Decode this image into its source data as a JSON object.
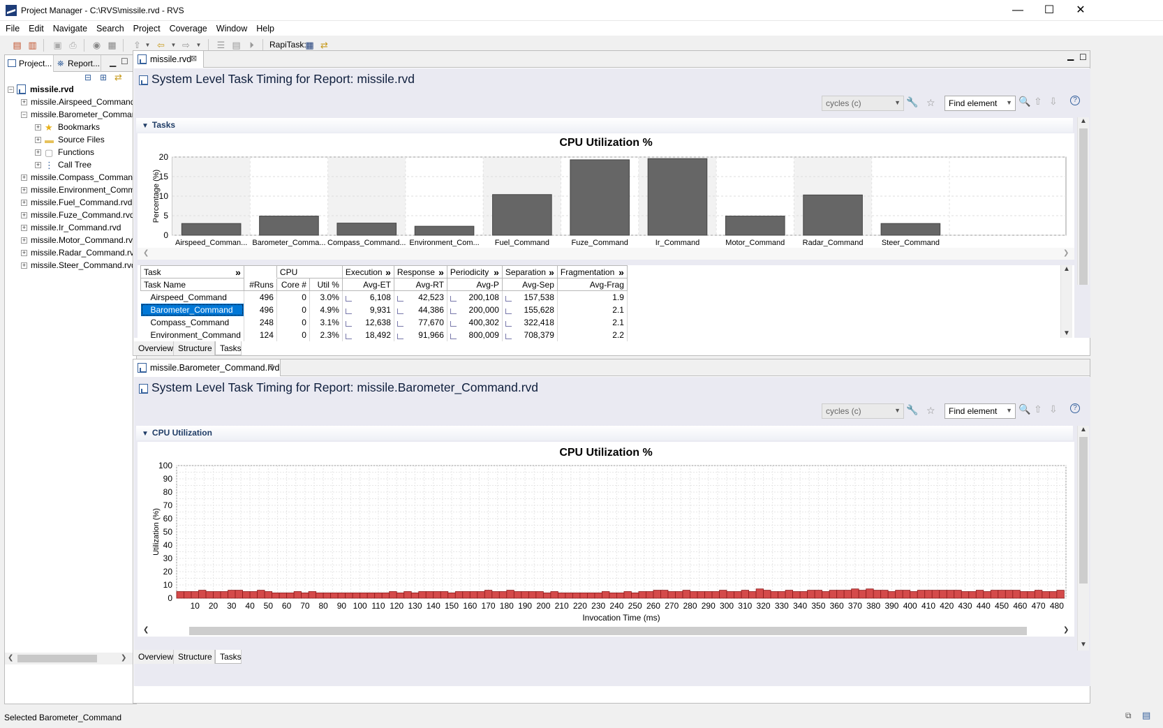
{
  "window": {
    "title": "Project Manager - C:\\RVS\\missile.rvd - RVS",
    "minimize": "—",
    "maximize": "☐",
    "close": "✕"
  },
  "menu": [
    "File",
    "Edit",
    "Navigate",
    "Search",
    "Project",
    "Coverage",
    "Window",
    "Help"
  ],
  "toolbar": {
    "rapitask_label": "RapiTask:"
  },
  "left_panel": {
    "tabs": [
      "Project...",
      "Report..."
    ],
    "tree": [
      {
        "label": "missile.rvd",
        "bold": true,
        "level": 0,
        "expander": "−"
      },
      {
        "label": "missile.Airspeed_Command.",
        "level": 1,
        "expander": "+"
      },
      {
        "label": "missile.Barometer_Comman",
        "level": 1,
        "expander": "−"
      },
      {
        "label": "Bookmarks",
        "level": 2,
        "expander": "+",
        "icon": "star-icon"
      },
      {
        "label": "Source Files",
        "level": 2,
        "expander": "+",
        "icon": "folder-icon"
      },
      {
        "label": "Functions",
        "level": 2,
        "expander": "+",
        "icon": "functions-icon"
      },
      {
        "label": "Call Tree",
        "level": 2,
        "expander": "+",
        "icon": "call-tree-icon"
      },
      {
        "label": "missile.Compass_Command",
        "level": 1,
        "expander": "+"
      },
      {
        "label": "missile.Environment_Comm",
        "level": 1,
        "expander": "+"
      },
      {
        "label": "missile.Fuel_Command.rvd",
        "level": 1,
        "expander": "+"
      },
      {
        "label": "missile.Fuze_Command.rvd",
        "level": 1,
        "expander": "+"
      },
      {
        "label": "missile.Ir_Command.rvd",
        "level": 1,
        "expander": "+"
      },
      {
        "label": "missile.Motor_Command.rv",
        "level": 1,
        "expander": "+"
      },
      {
        "label": "missile.Radar_Command.rvc",
        "level": 1,
        "expander": "+"
      },
      {
        "label": "missile.Steer_Command.rvd",
        "level": 1,
        "expander": "+"
      }
    ]
  },
  "top_editor": {
    "tab": "missile.rvd",
    "title": "System Level Task Timing for Report: missile.rvd",
    "units_combo": "cycles (c)",
    "find_combo": "Find element",
    "section": "Tasks",
    "bottom_tabs": [
      "Overview",
      "Structure",
      "Tasks"
    ],
    "table": {
      "group_headers": [
        "Task",
        "CPU",
        "Execution",
        "Response",
        "Periodicity",
        "Separation",
        "Fragmentation"
      ],
      "columns": [
        "Task Name",
        "#Runs",
        "Core #",
        "Util %",
        "Avg-ET",
        "Avg-RT",
        "Avg-P",
        "Avg-Sep",
        "Avg-Frag"
      ],
      "rows": [
        [
          "Airspeed_Command",
          "496",
          "0",
          "3.0%",
          "6,108",
          "42,523",
          "200,108",
          "157,538",
          "1.9"
        ],
        [
          "Barometer_Command",
          "496",
          "0",
          "4.9%",
          "9,931",
          "44,386",
          "200,000",
          "155,628",
          "2.1"
        ],
        [
          "Compass_Command",
          "248",
          "0",
          "3.1%",
          "12,638",
          "77,670",
          "400,302",
          "322,418",
          "2.1"
        ],
        [
          "Environment_Command",
          "124",
          "0",
          "2.3%",
          "18,492",
          "91,966",
          "800,009",
          "708,379",
          "2.2"
        ]
      ],
      "selected_row": 1
    }
  },
  "bottom_editor": {
    "tab": "missile.Barometer_Command.rvd",
    "title": "System Level Task Timing for Report: missile.Barometer_Command.rvd",
    "units_combo": "cycles (c)",
    "find_combo": "Find element",
    "section": "CPU Utilization",
    "bottom_tabs": [
      "Overview",
      "Structure",
      "Tasks"
    ]
  },
  "status": {
    "text": "Selected Barometer_Command"
  },
  "chart_data": [
    {
      "type": "bar",
      "title": "CPU Utilization %",
      "ylabel": "Percentage (%)",
      "xlabel": "",
      "ylim": [
        0,
        20
      ],
      "yticks": [
        0,
        5,
        10,
        15,
        20
      ],
      "categories": [
        "Airspeed_Comman...",
        "Barometer_Comma...",
        "Compass_Command...",
        "Environment_Com...",
        "Fuel_Command",
        "Fuze_Command",
        "Ir_Command",
        "Motor_Command",
        "Radar_Command",
        "Steer_Command"
      ],
      "values": [
        3.0,
        4.9,
        3.1,
        2.3,
        10.4,
        19.3,
        19.6,
        4.9,
        10.3,
        3.0
      ],
      "colors": {
        "bar": "#666666",
        "band": "#f2f2f2"
      }
    },
    {
      "type": "bar",
      "title": "CPU Utilization %",
      "ylabel": "Utilization (%)",
      "xlabel": "Invocation Time (ms)",
      "ylim": [
        0,
        100
      ],
      "yticks": [
        0,
        10,
        20,
        30,
        40,
        50,
        60,
        70,
        80,
        90,
        100
      ],
      "xticks": [
        10,
        20,
        30,
        40,
        50,
        60,
        70,
        80,
        90,
        100,
        110,
        120,
        130,
        140,
        150,
        160,
        170,
        180,
        190,
        200,
        210,
        220,
        230,
        240,
        250,
        260,
        270,
        280,
        290,
        300,
        310,
        320,
        330,
        340,
        350,
        360,
        370,
        380,
        390,
        400,
        410,
        420,
        430,
        440,
        450,
        460,
        470,
        480
      ],
      "xlim": [
        0,
        485
      ],
      "bar_width_ms": 4,
      "x_start_ms": 0,
      "values": [
        5,
        5,
        5,
        6,
        5,
        5,
        5,
        6,
        6,
        5,
        5,
        6,
        5,
        4,
        4,
        4,
        5,
        4,
        5,
        4,
        4,
        4,
        4,
        4,
        4,
        4,
        4,
        4,
        4,
        5,
        4,
        5,
        4,
        5,
        5,
        5,
        5,
        4,
        5,
        5,
        5,
        5,
        6,
        5,
        5,
        6,
        5,
        5,
        5,
        5,
        4,
        5,
        4,
        4,
        4,
        4,
        4,
        4,
        5,
        4,
        4,
        5,
        4,
        5,
        5,
        6,
        6,
        5,
        5,
        6,
        5,
        5,
        5,
        5,
        6,
        5,
        5,
        6,
        5,
        7,
        6,
        5,
        5,
        6,
        5,
        5,
        6,
        6,
        5,
        6,
        6,
        6,
        7,
        6,
        7,
        6,
        6,
        5,
        6,
        6,
        5,
        6,
        6,
        6,
        6,
        6,
        6,
        5,
        5,
        6,
        5,
        6,
        6,
        6,
        6,
        5,
        5,
        6,
        5,
        5,
        6,
        6
      ],
      "colors": {
        "bar": "#d44a4a",
        "edge": "#8e1c1c"
      }
    }
  ]
}
